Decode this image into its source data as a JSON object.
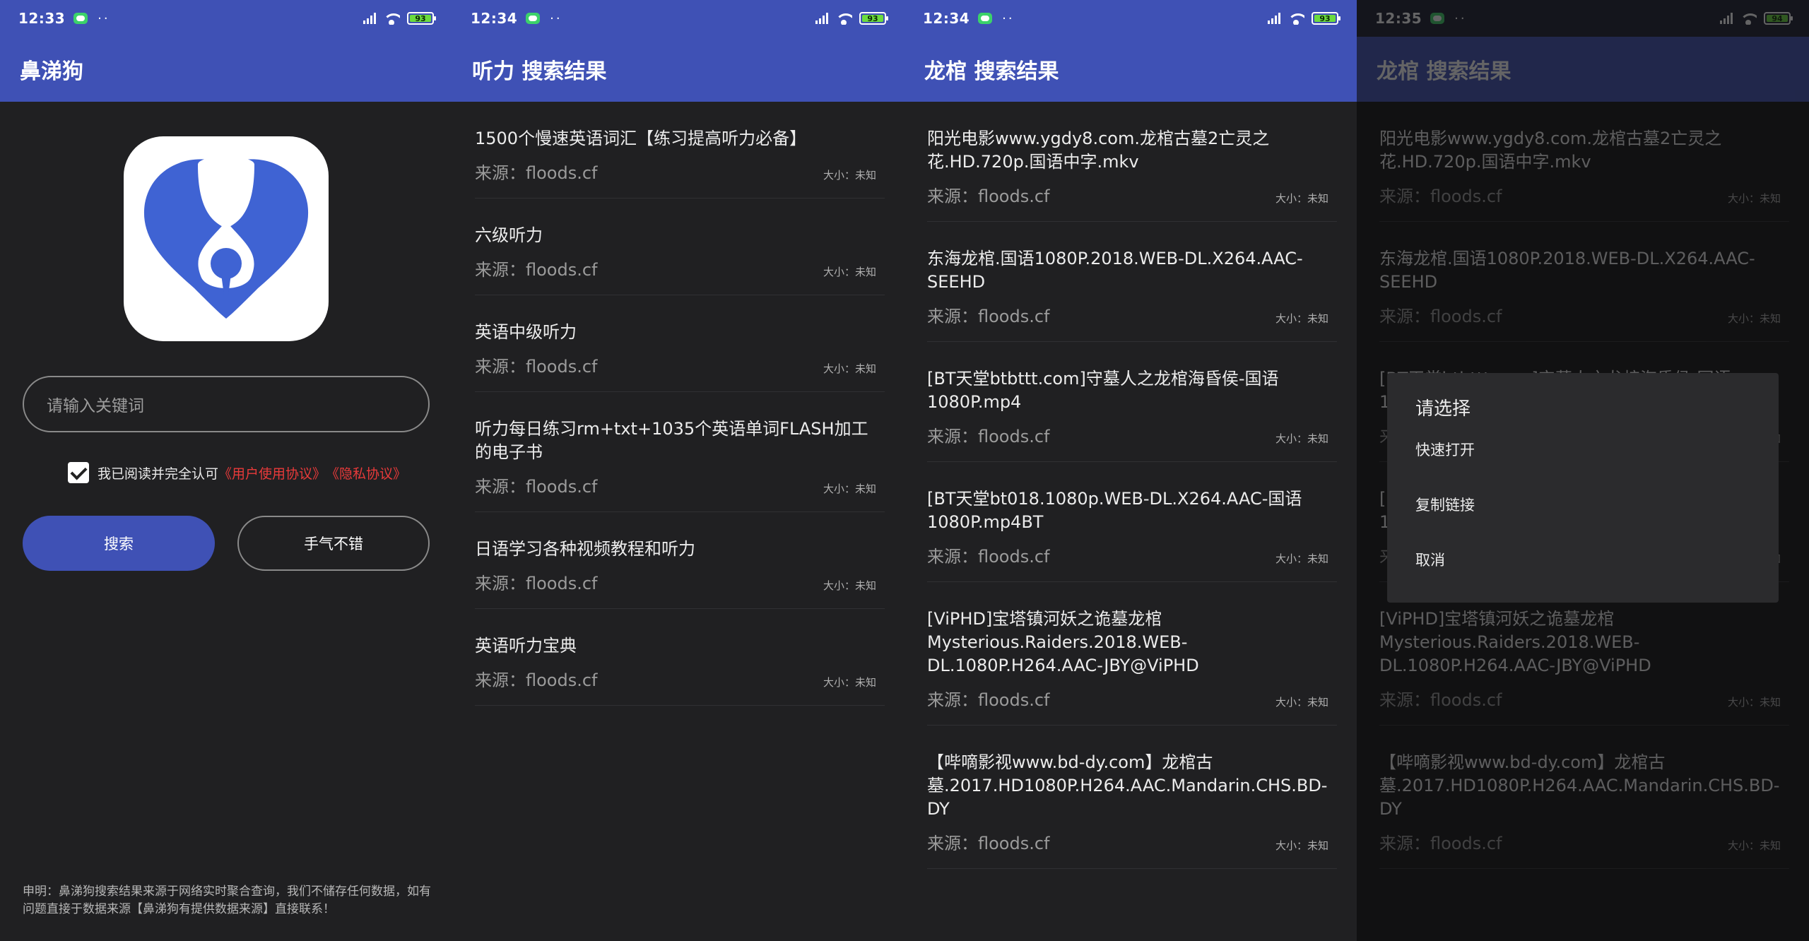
{
  "colors": {
    "primary": "#3f51b5",
    "accent_red": "#e83a3a",
    "background": "#202022"
  },
  "screens": [
    {
      "status": {
        "time": "12:33",
        "battery": "93"
      },
      "title": "鼻涕狗",
      "search": {
        "placeholder": "请输入关键词"
      },
      "agreement": {
        "checked": true,
        "text": "我已阅读并完全认可",
        "link1": "《用户使用协议》",
        "link2": "《隐私协议》"
      },
      "buttons": {
        "search": "搜索",
        "lucky": "手气不错"
      },
      "disclaimer": "申明：鼻涕狗搜索结果来源于网络实时聚合查询，我们不储存任何数据，如有问题直接于数据来源【鼻涕狗有提供数据来源】直接联系！",
      "logo_icon": "droplet-logo-icon"
    },
    {
      "status": {
        "time": "12:34",
        "battery": "93"
      },
      "title": "听力 搜索结果",
      "results": [
        {
          "title": "1500个慢速英语词汇【练习提高听力必备】",
          "source": "来源：floods.cf",
          "size": "大小：未知"
        },
        {
          "title": "六级听力",
          "source": "来源：floods.cf",
          "size": "大小：未知"
        },
        {
          "title": "英语中级听力",
          "source": "来源：floods.cf",
          "size": "大小：未知"
        },
        {
          "title": "听力每日练习rm+txt+1035个英语单词FLASH加工的电子书",
          "source": "来源：floods.cf",
          "size": "大小：未知"
        },
        {
          "title": "日语学习各种视频教程和听力",
          "source": "来源：floods.cf",
          "size": "大小：未知"
        },
        {
          "title": "英语听力宝典",
          "source": "来源：floods.cf",
          "size": "大小：未知"
        }
      ]
    },
    {
      "status": {
        "time": "12:34",
        "battery": "93"
      },
      "title": "龙棺 搜索结果",
      "results": [
        {
          "title": "阳光电影www.ygdy8.com.龙棺古墓2亡灵之花.HD.720p.国语中字.mkv",
          "source": "来源：floods.cf",
          "size": "大小：未知"
        },
        {
          "title": "东海龙棺.国语1080P.2018.WEB-DL.X264.AAC-SEEHD",
          "source": "来源：floods.cf",
          "size": "大小：未知"
        },
        {
          "title": "[BT天堂btbttt.com]守墓人之龙棺海昏侯-国语1080P.mp4",
          "source": "来源：floods.cf",
          "size": "大小：未知"
        },
        {
          "title": "[BT天堂bt018.1080p.WEB-DL.X264.AAC-国语1080P.mp4BT",
          "source": "来源：floods.cf",
          "size": "大小：未知"
        },
        {
          "title": "[ViPHD]宝塔镇河妖之诡墓龙棺 Mysterious.Raiders.2018.WEB-DL.1080P.H264.AAC-JBY@ViPHD",
          "source": "来源：floods.cf",
          "size": "大小：未知"
        },
        {
          "title": "【哔嘀影视www.bd-dy.com】龙棺古墓.2017.HD1080P.H264.AAC.Mandarin.CHS.BD-DY",
          "source": "来源：floods.cf",
          "size": "大小：未知"
        }
      ]
    },
    {
      "status": {
        "time": "12:35",
        "battery": "94"
      },
      "title": "龙棺 搜索结果",
      "dialog": {
        "title": "请选择",
        "options": [
          "快速打开",
          "复制链接",
          "取消"
        ]
      }
    }
  ]
}
